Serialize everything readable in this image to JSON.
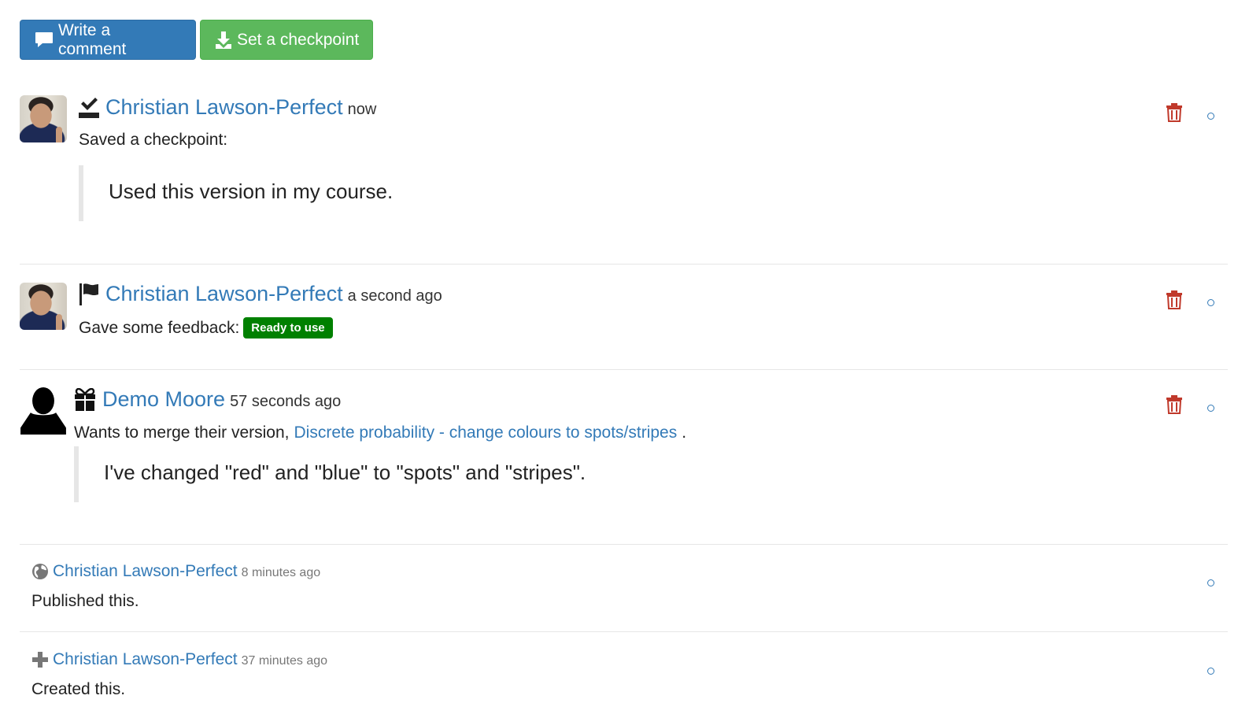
{
  "toolbar": {
    "comment_label": "Write a comment",
    "checkpoint_label": "Set a checkpoint"
  },
  "timeline": [
    {
      "kind": "checkpoint",
      "icon": "checkpoint-icon",
      "author": "Christian Lawson-Perfect",
      "time": "now",
      "text": "Saved a checkpoint:",
      "quote": "Used this version in my course."
    },
    {
      "kind": "feedback",
      "icon": "flag-icon",
      "author": "Christian Lawson-Perfect",
      "time": "a second ago",
      "text": "Gave some feedback:",
      "badge": "Ready to use",
      "badge_color": "#008000"
    },
    {
      "kind": "merge-request",
      "icon": "gift-icon",
      "author": "Demo Moore",
      "time": "57 seconds ago",
      "text": "Wants to merge their version,",
      "link": "Discrete probability - change colours to spots/stripes",
      "suffix": ".",
      "quote": "I've changed \"red\" and \"blue\" to \"spots\" and \"stripes\"."
    },
    {
      "kind": "publish",
      "icon": "globe-icon",
      "author": "Christian Lawson-Perfect",
      "time": "8 minutes ago",
      "text": "Published this."
    },
    {
      "kind": "create",
      "icon": "plus-icon",
      "author": "Christian Lawson-Perfect",
      "time": "37 minutes ago",
      "text": "Created this."
    }
  ],
  "colors": {
    "primary": "#337ab7",
    "success": "#5cb85c",
    "danger": "#c0392b",
    "badge": "#008000"
  }
}
